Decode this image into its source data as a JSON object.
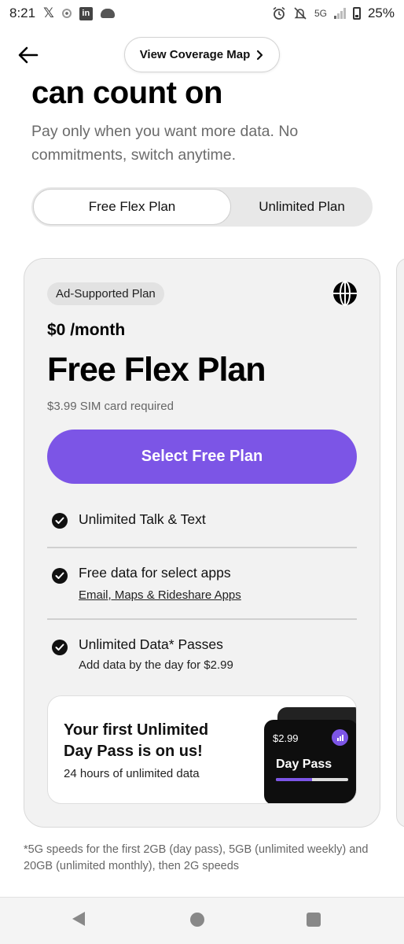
{
  "status_bar": {
    "time": "8:21",
    "network": "5G",
    "battery": "25%",
    "icons": [
      "x-icon",
      "record-icon",
      "linkedin-icon",
      "cloud-icon",
      "alarm-icon",
      "mute-icon",
      "signal-icon",
      "battery-icon"
    ]
  },
  "header": {
    "back_icon": "arrow-left-icon",
    "coverage_label": "View Coverage Map",
    "coverage_icon": "chevron-right-icon"
  },
  "hero": {
    "headline": "can count on",
    "subtext": "Pay only when you want more data. No commitments, switch anytime."
  },
  "plan_toggle": {
    "options": [
      "Free Flex Plan",
      "Unlimited Plan"
    ],
    "selected": "Free Flex Plan"
  },
  "plan_card": {
    "badge": "Ad-Supported Plan",
    "badge_icon": "globe-icon",
    "price": "$0 /month",
    "title": "Free Flex Plan",
    "sim_note": "$3.99 SIM card required",
    "cta": "Select Free Plan",
    "features": [
      {
        "title": "Unlimited Talk & Text",
        "sub": ""
      },
      {
        "title": "Free data for select apps",
        "sub": "Email, Maps & Rideshare Apps"
      },
      {
        "title": "Unlimited Data* Passes",
        "sub": "Add data by the day for $2.99"
      }
    ],
    "promo": {
      "title": "Your first Unlimited Day Pass is on us!",
      "subtitle": "24 hours of unlimited data",
      "pass_price": "$2.99",
      "pass_name": "Day Pass",
      "pass_progress": 0.5
    }
  },
  "footnote": "*5G speeds for the first 2GB (day pass), 5GB (unlimited weekly) and 20GB (unlimited monthly), then 2G speeds",
  "colors": {
    "accent": "#7c55e6",
    "card_bg": "#f2f2f2",
    "toggle_bg": "#e8e8e8"
  },
  "nav_bar": {
    "icons": [
      "back-triangle-icon",
      "home-circle-icon",
      "recents-square-icon"
    ]
  }
}
